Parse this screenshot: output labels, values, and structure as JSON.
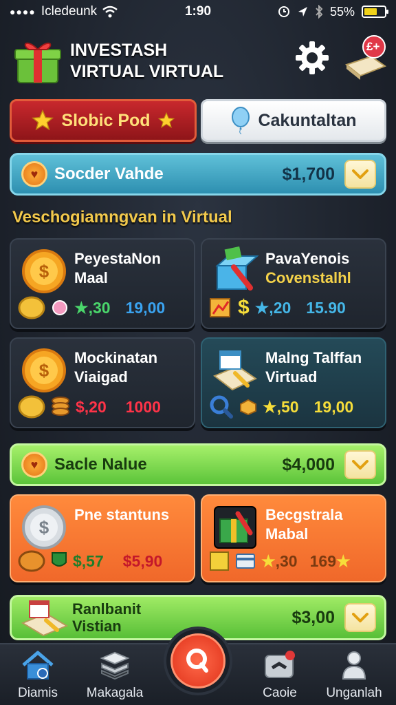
{
  "status_bar": {
    "carrier": "Icledeunk",
    "time": "1:90",
    "battery": "55%",
    "battery_level": 0.55
  },
  "header": {
    "title_line1": "INVESTASH",
    "title_line2": "VIRTUAL VIRTUAL",
    "notification_badge": "£+"
  },
  "tabs": [
    {
      "label": "Slobic Pod",
      "active": true
    },
    {
      "label": "Cakuntaltan",
      "active": false
    }
  ],
  "value_bars": [
    {
      "label": "Socder Vahde",
      "value": "$1,700"
    },
    {
      "label": "Sacle Nalue",
      "value": "$4,000"
    },
    {
      "label_line1": "Ranlbanit",
      "label_line2": "Vistian",
      "value": "$3,00"
    }
  ],
  "section_heading": "Veschogiamngvan in Virtual",
  "cards": [
    {
      "title_line1": "PeyestaNon",
      "title_line2": "Maal",
      "stat_a": "30",
      "stat_b": "19,00"
    },
    {
      "title_line1": "PavaYenois",
      "title_line2": "Covenstalhl",
      "stat_a": "20",
      "stat_b": "15.90"
    },
    {
      "title_line1": "Mockinatan",
      "title_line2": "Viaigad",
      "stat_a": "$,20",
      "stat_b": "1000"
    },
    {
      "title_line1": "Malng Talffan",
      "title_line2": "Virtuad",
      "stat_a": "50",
      "stat_b": "19,00"
    },
    {
      "title_line1": "Pne stantuns",
      "title_line2": "",
      "stat_a": "$,57",
      "stat_b": "$5,90"
    },
    {
      "title_line1": "Becgstrala",
      "title_line2": "Mabal",
      "stat_a": "30",
      "stat_b": "169"
    }
  ],
  "bottom_nav": [
    {
      "label": "Diamis",
      "icon": "home-icon"
    },
    {
      "label": "Makagala",
      "icon": "stack-icon"
    },
    {
      "label": "Caoie",
      "icon": "chat-icon"
    },
    {
      "label": "Unganlah",
      "icon": "user-icon"
    }
  ],
  "colors": {
    "accent_red": "#c8282d",
    "accent_blue": "#2d8fb0",
    "accent_green": "#5cc43a",
    "accent_orange": "#f0682a",
    "heading_gold": "#f2c94c"
  }
}
